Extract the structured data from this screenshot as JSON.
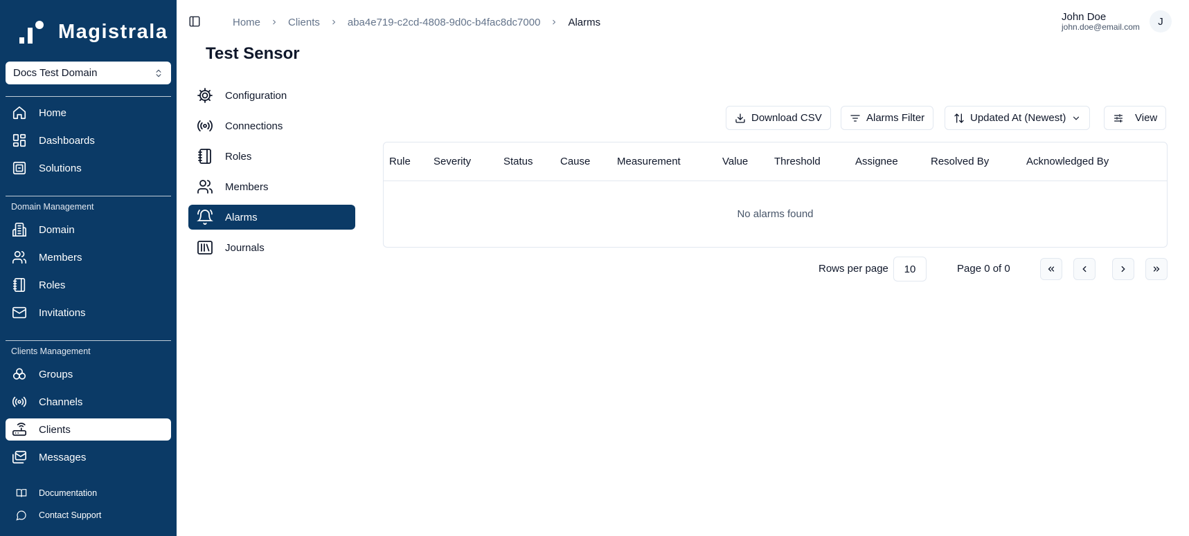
{
  "brand": {
    "name": "Magistrala"
  },
  "domain_select": {
    "value": "Docs Test Domain"
  },
  "sidebar": {
    "main_items": [
      {
        "label": "Home",
        "icon": "home-icon"
      },
      {
        "label": "Dashboards",
        "icon": "dashboard-icon"
      },
      {
        "label": "Solutions",
        "icon": "solutions-icon"
      }
    ],
    "domain_group_label": "Domain Management",
    "domain_items": [
      {
        "label": "Domain",
        "icon": "building-icon"
      },
      {
        "label": "Members",
        "icon": "users-icon"
      },
      {
        "label": "Roles",
        "icon": "notebook-icon"
      },
      {
        "label": "Invitations",
        "icon": "mail-icon"
      }
    ],
    "clients_group_label": "Clients Management",
    "clients_items": [
      {
        "label": "Groups",
        "icon": "groups-icon"
      },
      {
        "label": "Channels",
        "icon": "radio-icon"
      },
      {
        "label": "Clients",
        "icon": "router-icon",
        "active": true
      },
      {
        "label": "Messages",
        "icon": "messages-icon"
      }
    ],
    "footer_items": [
      {
        "label": "Documentation",
        "icon": "book-icon"
      },
      {
        "label": "Contact Support",
        "icon": "chat-icon"
      }
    ]
  },
  "breadcrumb": [
    "Home",
    "Clients",
    "aba4e719-c2cd-4808-9d0c-b4fac8dc7000",
    "Alarms"
  ],
  "user": {
    "name": "John Doe",
    "email": "john.doe@email.com",
    "initial": "J"
  },
  "page_title": "Test Sensor",
  "subnav": [
    {
      "label": "Configuration",
      "icon": "gear-icon"
    },
    {
      "label": "Connections",
      "icon": "radio-icon"
    },
    {
      "label": "Roles",
      "icon": "notebook-icon"
    },
    {
      "label": "Members",
      "icon": "users-icon"
    },
    {
      "label": "Alarms",
      "icon": "bell-icon",
      "active": true
    },
    {
      "label": "Journals",
      "icon": "library-icon"
    }
  ],
  "toolbar": {
    "download_label": "Download CSV",
    "filter_label": "Alarms Filter",
    "sort_label": "Updated At (Newest)",
    "view_label": "View"
  },
  "table": {
    "columns": [
      "Rule",
      "Severity",
      "Status",
      "Cause",
      "Measurement",
      "Value",
      "Threshold",
      "Assignee",
      "Resolved By",
      "Acknowledged By"
    ],
    "empty_text": "No alarms found"
  },
  "pagination": {
    "rows_per_page_label": "Rows per page",
    "rows_per_page_value": "10",
    "page_info": "Page 0 of 0"
  },
  "colors": {
    "sidebar_bg": "#0b3a66",
    "active_bg": "#0b3a66",
    "border": "#e2e8f0"
  }
}
